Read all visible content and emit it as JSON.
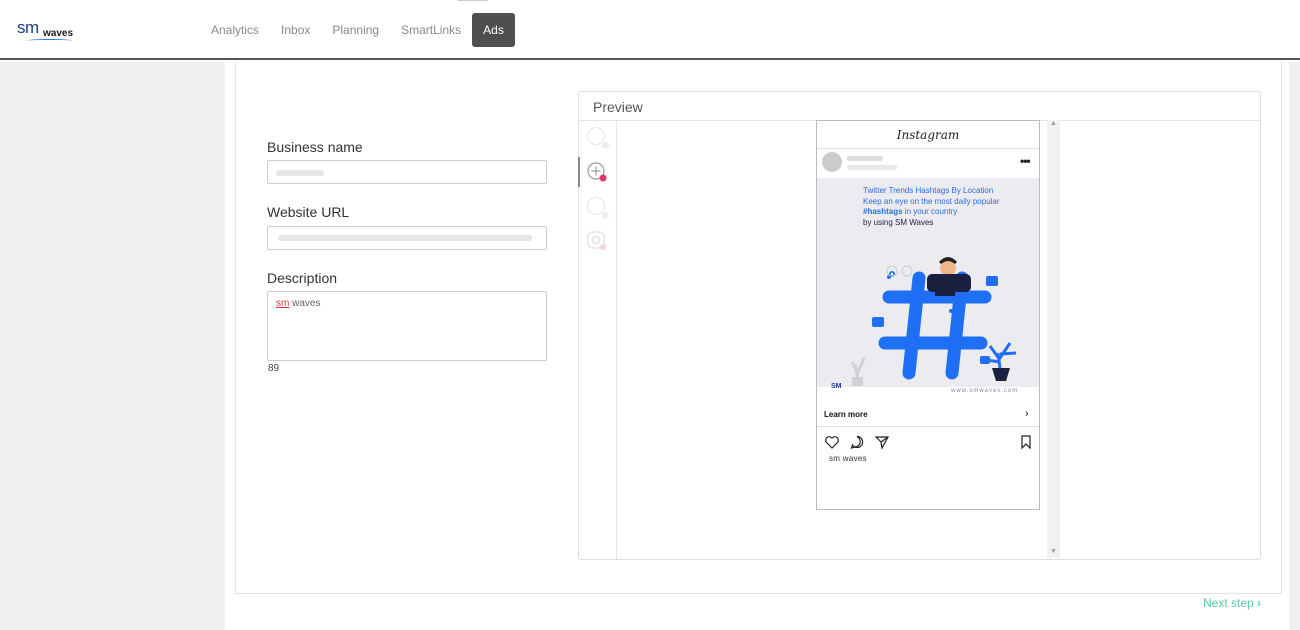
{
  "brand": {
    "logo_sm": "sm",
    "logo_waves": "waves"
  },
  "nav": {
    "items": [
      {
        "label": "Analytics"
      },
      {
        "label": "Inbox"
      },
      {
        "label": "Planning"
      },
      {
        "label": "SmartLinks"
      },
      {
        "label": "Ads",
        "active": true
      }
    ]
  },
  "form": {
    "business_name_label": "Business name",
    "website_url_label": "Website URL",
    "description_label": "Description",
    "description_value_misspelled": "sm",
    "description_value_rest": " waves",
    "char_counter": "89"
  },
  "preview": {
    "title": "Preview",
    "platforms": [
      "placeholder-icon",
      "add-account-icon",
      "placeholder-icon",
      "instagram-icon"
    ],
    "instagram_header": "Instagram",
    "image_text": {
      "line1": "Twitter Trends Hashtags By Location",
      "line2": "Keep an eye on the most daily popular",
      "line3_bold": "#hashtags",
      "line3_rest": " in your country",
      "line4": "by using SM Waves"
    },
    "image_logo": "SM",
    "image_url": "www.smwaves.com",
    "cta_label": "Learn more",
    "caption": "sm waves"
  },
  "footer": {
    "next_step_label": "Next step"
  },
  "colors": {
    "accent": "#5cc8a8",
    "hashtag_blue": "#1f6ff5",
    "active_nav": "#4f4f4f",
    "notif": "#e0386a"
  }
}
